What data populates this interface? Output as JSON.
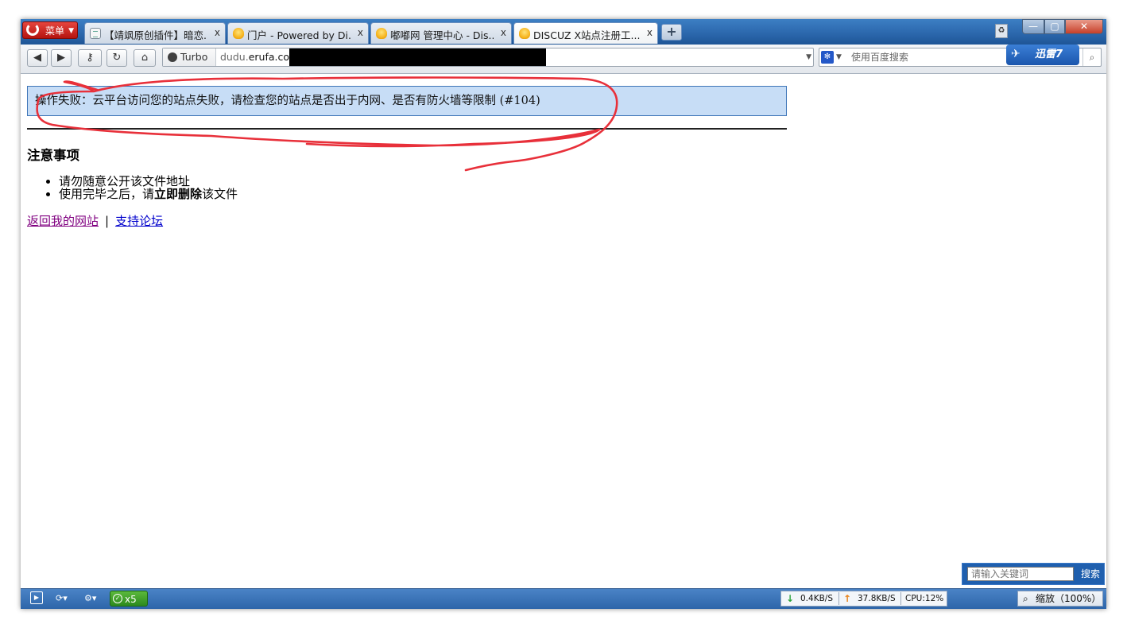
{
  "browser": {
    "menu_label": "菜单",
    "tabs": [
      {
        "title": "【靖飒原创插件】暗恋...",
        "close": "x",
        "icon": "page-icon"
      },
      {
        "title": "门户 - Powered by Di...",
        "close": "x",
        "icon": "discuz-icon"
      },
      {
        "title": "嘟嘟网 管理中心 - Dis...",
        "close": "x",
        "icon": "discuz-icon"
      },
      {
        "title": "DISCUZ X站点注册工...",
        "close": "x",
        "icon": "discuz-icon"
      }
    ],
    "new_tab": "+",
    "turbo_label": "Turbo",
    "url_prefix": "dudu.",
    "url_domain": "erufa.com",
    "search_placeholder": "使用百度搜索",
    "xunlei_label": "迅雷7",
    "window_controls": {
      "minimize": "—",
      "maximize": "▢",
      "close": "✕"
    }
  },
  "page": {
    "error_message": "操作失败：云平台访问您的站点失败，请检查您的站点是否出于内网、是否有防火墙等限制 (#104)",
    "notice_title": "注意事项",
    "notice_items": {
      "item1": "请勿随意公开该文件地址",
      "item2_pre": "使用完毕之后，请",
      "item2_bold": "立即删除",
      "item2_post": "该文件"
    },
    "links": {
      "back": "返回我的网站",
      "separator": "|",
      "support": "支持论坛"
    },
    "keyword_placeholder": "请输入关键词",
    "keyword_button": "搜索"
  },
  "statusbar": {
    "x5_label": "x5",
    "download_speed": "0.4KB/S",
    "upload_speed": "37.8KB/S",
    "cpu": "CPU:12%",
    "zoom": "缩放（100%）"
  },
  "colors": {
    "alert_bg": "#c7ddf6",
    "alert_border": "#3f76b8",
    "annotation_red": "#e8303a",
    "visited_link": "#800080",
    "link": "#0000cc"
  }
}
